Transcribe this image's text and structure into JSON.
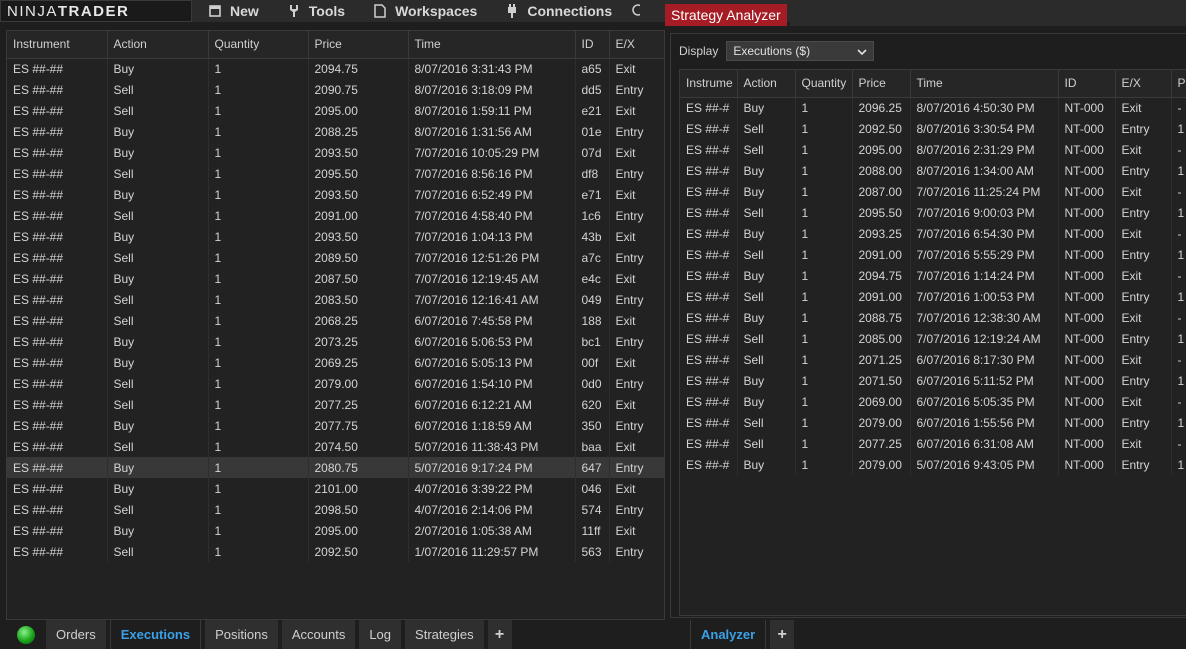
{
  "topbar": {
    "logo_light": "NINJA",
    "logo_bold": "TRADER",
    "menu": [
      {
        "label": "New",
        "icon": "new-icon"
      },
      {
        "label": "Tools",
        "icon": "tools-icon"
      },
      {
        "label": "Workspaces",
        "icon": "workspaces-icon"
      },
      {
        "label": "Connections",
        "icon": "connections-icon"
      }
    ]
  },
  "executions": {
    "columns": [
      "Instrument",
      "Action",
      "Quantity",
      "Price",
      "Time",
      "ID",
      "E/X"
    ],
    "rows": [
      [
        "ES ##-##",
        "Buy",
        "1",
        "2094.75",
        "8/07/2016 3:31:43 PM",
        "a65",
        "Exit"
      ],
      [
        "ES ##-##",
        "Sell",
        "1",
        "2090.75",
        "8/07/2016 3:18:09 PM",
        "dd5",
        "Entry"
      ],
      [
        "ES ##-##",
        "Sell",
        "1",
        "2095.00",
        "8/07/2016 1:59:11 PM",
        "e21",
        "Exit"
      ],
      [
        "ES ##-##",
        "Buy",
        "1",
        "2088.25",
        "8/07/2016 1:31:56 AM",
        "01e",
        "Entry"
      ],
      [
        "ES ##-##",
        "Buy",
        "1",
        "2093.50",
        "7/07/2016 10:05:29 PM",
        "07d",
        "Exit"
      ],
      [
        "ES ##-##",
        "Sell",
        "1",
        "2095.50",
        "7/07/2016 8:56:16 PM",
        "df8",
        "Entry"
      ],
      [
        "ES ##-##",
        "Buy",
        "1",
        "2093.50",
        "7/07/2016 6:52:49 PM",
        "e71",
        "Exit"
      ],
      [
        "ES ##-##",
        "Sell",
        "1",
        "2091.00",
        "7/07/2016 4:58:40 PM",
        "1c6",
        "Entry"
      ],
      [
        "ES ##-##",
        "Buy",
        "1",
        "2093.50",
        "7/07/2016 1:04:13 PM",
        "43b",
        "Exit"
      ],
      [
        "ES ##-##",
        "Sell",
        "1",
        "2089.50",
        "7/07/2016 12:51:26 PM",
        "a7c",
        "Entry"
      ],
      [
        "ES ##-##",
        "Buy",
        "1",
        "2087.50",
        "7/07/2016 12:19:45 AM",
        "e4c",
        "Exit"
      ],
      [
        "ES ##-##",
        "Sell",
        "1",
        "2083.50",
        "7/07/2016 12:16:41 AM",
        "049",
        "Entry"
      ],
      [
        "ES ##-##",
        "Sell",
        "1",
        "2068.25",
        "6/07/2016 7:45:58 PM",
        "188",
        "Exit"
      ],
      [
        "ES ##-##",
        "Buy",
        "1",
        "2073.25",
        "6/07/2016 5:06:53 PM",
        "bc1",
        "Entry"
      ],
      [
        "ES ##-##",
        "Buy",
        "1",
        "2069.25",
        "6/07/2016 5:05:13 PM",
        "00f",
        "Exit"
      ],
      [
        "ES ##-##",
        "Sell",
        "1",
        "2079.00",
        "6/07/2016 1:54:10 PM",
        "0d0",
        "Entry"
      ],
      [
        "ES ##-##",
        "Sell",
        "1",
        "2077.25",
        "6/07/2016 6:12:21 AM",
        "620",
        "Exit"
      ],
      [
        "ES ##-##",
        "Buy",
        "1",
        "2077.75",
        "6/07/2016 1:18:59 AM",
        "350",
        "Entry"
      ],
      [
        "ES ##-##",
        "Sell",
        "1",
        "2074.50",
        "5/07/2016 11:38:43 PM",
        "baa",
        "Exit"
      ],
      [
        "ES ##-##",
        "Buy",
        "1",
        "2080.75",
        "5/07/2016 9:17:24 PM",
        "647",
        "Entry"
      ],
      [
        "ES ##-##",
        "Buy",
        "1",
        "2101.00",
        "4/07/2016 3:39:22 PM",
        "046",
        "Exit"
      ],
      [
        "ES ##-##",
        "Sell",
        "1",
        "2098.50",
        "4/07/2016 2:14:06 PM",
        "574",
        "Entry"
      ],
      [
        "ES ##-##",
        "Buy",
        "1",
        "2095.00",
        "2/07/2016 1:05:38 AM",
        "11ff",
        "Exit"
      ],
      [
        "ES ##-##",
        "Sell",
        "1",
        "2092.50",
        "1/07/2016 11:29:57 PM",
        "563",
        "Entry"
      ]
    ]
  },
  "bottom_tabs": [
    "Orders",
    "Executions",
    "Positions",
    "Accounts",
    "Log",
    "Strategies"
  ],
  "bottom_active": "Executions",
  "add_tab": "+",
  "analyzer": {
    "title": "Strategy Analyzer",
    "display_label": "Display",
    "display_value": "Executions ($)",
    "columns": [
      "Instrume",
      "Action",
      "Quantity",
      "Price",
      "Time",
      "ID",
      "E/X",
      "P"
    ],
    "rows": [
      [
        "ES ##-#",
        "Buy",
        "1",
        "2096.25",
        "8/07/2016 4:50:30 PM",
        "NT-000",
        "Exit",
        "-"
      ],
      [
        "ES ##-#",
        "Sell",
        "1",
        "2092.50",
        "8/07/2016 3:30:54 PM",
        "NT-000",
        "Entry",
        "1"
      ],
      [
        "ES ##-#",
        "Sell",
        "1",
        "2095.00",
        "8/07/2016 2:31:29 PM",
        "NT-000",
        "Exit",
        "-"
      ],
      [
        "ES ##-#",
        "Buy",
        "1",
        "2088.00",
        "8/07/2016 1:34:00 AM",
        "NT-000",
        "Entry",
        "1"
      ],
      [
        "ES ##-#",
        "Buy",
        "1",
        "2087.00",
        "7/07/2016 11:25:24 PM",
        "NT-000",
        "Exit",
        "-"
      ],
      [
        "ES ##-#",
        "Sell",
        "1",
        "2095.50",
        "7/07/2016 9:00:03 PM",
        "NT-000",
        "Entry",
        "1"
      ],
      [
        "ES ##-#",
        "Buy",
        "1",
        "2093.25",
        "7/07/2016 6:54:30 PM",
        "NT-000",
        "Exit",
        "-"
      ],
      [
        "ES ##-#",
        "Sell",
        "1",
        "2091.00",
        "7/07/2016 5:55:29 PM",
        "NT-000",
        "Entry",
        "1"
      ],
      [
        "ES ##-#",
        "Buy",
        "1",
        "2094.75",
        "7/07/2016 1:14:24 PM",
        "NT-000",
        "Exit",
        "-"
      ],
      [
        "ES ##-#",
        "Sell",
        "1",
        "2091.00",
        "7/07/2016 1:00:53 PM",
        "NT-000",
        "Entry",
        "1"
      ],
      [
        "ES ##-#",
        "Buy",
        "1",
        "2088.75",
        "7/07/2016 12:38:30 AM",
        "NT-000",
        "Exit",
        "-"
      ],
      [
        "ES ##-#",
        "Sell",
        "1",
        "2085.00",
        "7/07/2016 12:19:24 AM",
        "NT-000",
        "Entry",
        "1"
      ],
      [
        "ES ##-#",
        "Sell",
        "1",
        "2071.25",
        "6/07/2016 8:17:30 PM",
        "NT-000",
        "Exit",
        "-"
      ],
      [
        "ES ##-#",
        "Buy",
        "1",
        "2071.50",
        "6/07/2016 5:11:52 PM",
        "NT-000",
        "Entry",
        "1"
      ],
      [
        "ES ##-#",
        "Buy",
        "1",
        "2069.00",
        "6/07/2016 5:05:35 PM",
        "NT-000",
        "Exit",
        "-"
      ],
      [
        "ES ##-#",
        "Sell",
        "1",
        "2079.00",
        "6/07/2016 1:55:56 PM",
        "NT-000",
        "Entry",
        "1"
      ],
      [
        "ES ##-#",
        "Sell",
        "1",
        "2077.25",
        "6/07/2016 6:31:08 AM",
        "NT-000",
        "Exit",
        "-"
      ],
      [
        "ES ##-#",
        "Buy",
        "1",
        "2079.00",
        "5/07/2016 9:43:05 PM",
        "NT-000",
        "Entry",
        "1"
      ]
    ],
    "tabs": [
      "Analyzer"
    ],
    "active_tab": "Analyzer"
  },
  "colors": {
    "accent": "#3aa0e8",
    "title_red": "#a51c24",
    "status_green": "#19a519"
  }
}
